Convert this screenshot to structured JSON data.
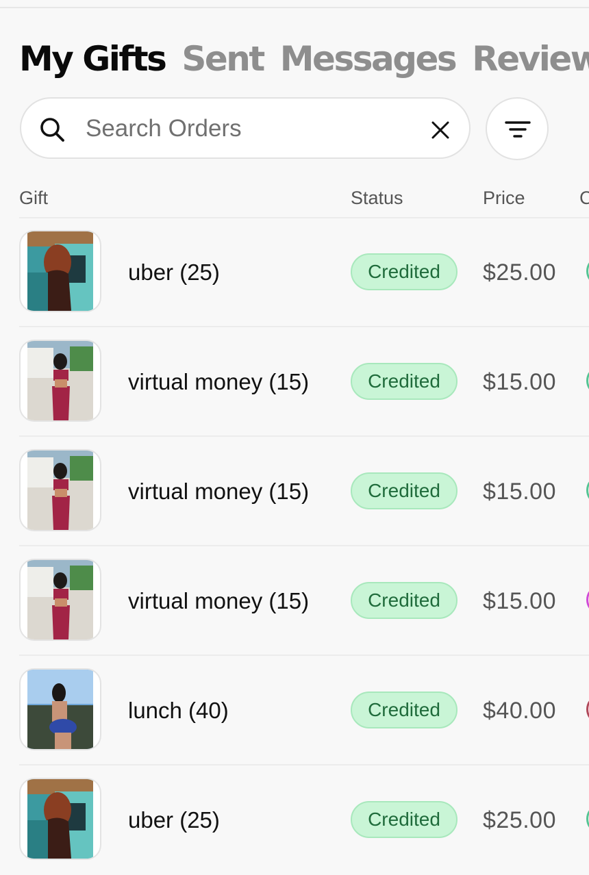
{
  "tabs": [
    {
      "label": "My Gifts",
      "active": true
    },
    {
      "label": "Sent",
      "active": false
    },
    {
      "label": "Messages",
      "active": false
    },
    {
      "label": "Reviews",
      "active": false
    }
  ],
  "search": {
    "placeholder": "Search Orders",
    "value": ""
  },
  "icons": {
    "search": "search-icon",
    "clear": "close-icon",
    "filter": "filter-icon"
  },
  "table": {
    "columns": [
      "Gift",
      "Status",
      "Price",
      "C"
    ],
    "rows": [
      {
        "gift": "uber (25)",
        "status": "Credited",
        "price": "$25.00",
        "photo": "car-scene",
        "edge_color": "#54c594"
      },
      {
        "gift": "virtual money (15)",
        "status": "Credited",
        "price": "$15.00",
        "photo": "street-scene",
        "edge_color": "#54c594"
      },
      {
        "gift": "virtual money (15)",
        "status": "Credited",
        "price": "$15.00",
        "photo": "street-scene",
        "edge_color": "#54c594"
      },
      {
        "gift": "virtual money (15)",
        "status": "Credited",
        "price": "$15.00",
        "photo": "street-scene",
        "edge_color": "#d04ad8"
      },
      {
        "gift": "lunch (40)",
        "status": "Credited",
        "price": "$40.00",
        "photo": "balcony-scene",
        "edge_color": "#b0485a"
      },
      {
        "gift": "uber (25)",
        "status": "Credited",
        "price": "$25.00",
        "photo": "car-scene",
        "edge_color": "#54c594"
      }
    ]
  },
  "colors": {
    "credited_badge_bg": "#c9f5d6",
    "credited_badge_text": "#1f6b3b",
    "active_tab": "#0a0a0a",
    "inactive_tab": "#8e8e8e"
  }
}
